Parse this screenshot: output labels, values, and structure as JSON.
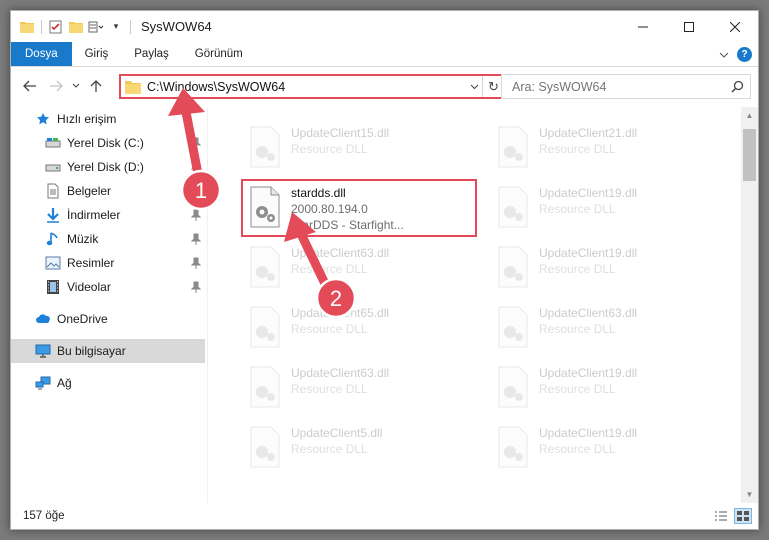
{
  "window": {
    "title": "SysWOW64"
  },
  "ribbon": {
    "tabs": [
      {
        "label": "Dosya",
        "active": true
      },
      {
        "label": "Giriş",
        "active": false
      },
      {
        "label": "Paylaş",
        "active": false
      },
      {
        "label": "Görünüm",
        "active": false
      }
    ],
    "expand_icon": "chevron-down-icon",
    "help_label": "?"
  },
  "address": {
    "path": "C:\\Windows\\SysWOW64",
    "refresh_glyph": "↻"
  },
  "search": {
    "placeholder": "Ara: SysWOW64"
  },
  "nav": {
    "items": [
      {
        "label": "Hızlı erişim",
        "icon": "star-icon",
        "pinned": false
      },
      {
        "label": "Yerel Disk (C:)",
        "icon": "drive-icon",
        "pinned": true
      },
      {
        "label": "Yerel Disk (D:)",
        "icon": "drive-icon",
        "pinned": true
      },
      {
        "label": "Belgeler",
        "icon": "documents-icon",
        "pinned": true
      },
      {
        "label": "İndirmeler",
        "icon": "download-icon",
        "pinned": true
      },
      {
        "label": "Müzik",
        "icon": "music-icon",
        "pinned": true
      },
      {
        "label": "Resimler",
        "icon": "pictures-icon",
        "pinned": true
      },
      {
        "label": "Videolar",
        "icon": "videos-icon",
        "pinned": true
      },
      {
        "label": "OneDrive",
        "icon": "cloud-icon",
        "pinned": false
      },
      {
        "label": "Bu bilgisayar",
        "icon": "computer-icon",
        "pinned": false,
        "selected": true
      },
      {
        "label": "Ağ",
        "icon": "network-icon",
        "pinned": false
      }
    ]
  },
  "files": {
    "left": [
      {
        "name": "UpdateClient15.dll",
        "sub": "Resource DLL",
        "faded": true
      },
      {
        "name": "stardds.dll",
        "sub": "2000.80.194.0",
        "sub2": "StarDDS - Starfight...",
        "faded": false,
        "highlighted": true
      },
      {
        "name": "UpdateClient63.dll",
        "sub": "Resource DLL",
        "faded": true
      },
      {
        "name": "UpdateClient65.dll",
        "sub": "Resource DLL",
        "faded": true
      },
      {
        "name": "UpdateClient63.dll",
        "sub": "Resource DLL",
        "faded": true
      },
      {
        "name": "UpdateClient5.dll",
        "sub": "Resource DLL",
        "faded": true
      }
    ],
    "right": [
      {
        "name": "UpdateClient21.dll",
        "sub": "Resource DLL",
        "faded": true
      },
      {
        "name": "UpdateClient19.dll",
        "sub": "Resource DLL",
        "faded": true
      },
      {
        "name": "UpdateClient19.dll",
        "sub": "Resource DLL",
        "faded": true
      },
      {
        "name": "UpdateClient63.dll",
        "sub": "Resource DLL",
        "faded": true
      },
      {
        "name": "UpdateClient19.dll",
        "sub": "Resource DLL",
        "faded": true
      },
      {
        "name": "UpdateClient19.dll",
        "sub": "Resource DLL",
        "faded": true
      }
    ]
  },
  "status": {
    "count": "157 öğe"
  },
  "annotations": {
    "marker1": "1",
    "marker2": "2",
    "color": "#e24b57"
  }
}
